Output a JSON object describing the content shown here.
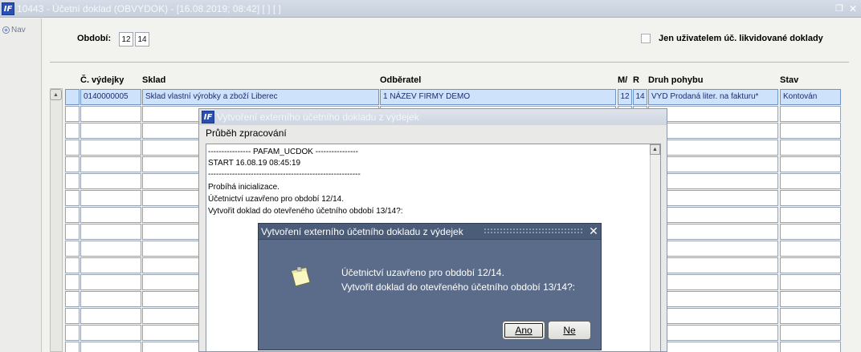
{
  "window": {
    "title": "10443 - Účetní doklad (OBVYDOK) - [16.08.2019; 08:42]  [ ]  [ ]",
    "logo": "IF",
    "restore_icon": "restore-icon",
    "close_icon": "close-icon"
  },
  "nav": {
    "label": "Nav"
  },
  "filters": {
    "obdobi_label": "Období:",
    "obdobi_from": "12",
    "obdobi_to": "14",
    "checkbox_label": "Jen uživatelem úč. likvidované doklady",
    "checkbox_checked": false
  },
  "table": {
    "columns": [
      "Č. výdejky",
      "Sklad",
      "Odběratel",
      "M/",
      "R",
      "Druh pohybu",
      "Stav"
    ],
    "rows": [
      [
        "0140000005",
        "Sklad vlastní výrobky a zboží Liberec",
        "1 NÁZEV FIRMY DEMO",
        "12",
        "14",
        "VYD Prodaná liter. na fakturu*",
        "Kontován"
      ]
    ]
  },
  "progress_window": {
    "title": "Vytvoření externího účetního dokladu z výdejek",
    "subtitle": "Průběh zpracování",
    "log": [
      "---------------- PAFAM_UCDOK ----------------",
      "START 16.08.19 08:45:19",
      "---------------------------------------------------------",
      "Probíhá inicializace.",
      "Účetnictví uzavřeno pro období 12/14.",
      "Vytvořit doklad do otevřeného účetního období 13/14?:"
    ]
  },
  "dialog": {
    "title": "Vytvoření externího účetního dokladu z výdejek",
    "message_line1": "Účetnictví uzavřeno pro období 12/14.",
    "message_line2": "Vytvořit doklad do otevřeného účetního období 13/14?:",
    "yes_label": "Ano",
    "no_label": "Ne",
    "icon": "note-icon",
    "close_label": "✕"
  },
  "colors": {
    "title_bar": "#c6cfdc",
    "dialog_bg": "#5a6c89",
    "selected_row": "#cfe2fb",
    "link_text": "#1a2d6a"
  }
}
